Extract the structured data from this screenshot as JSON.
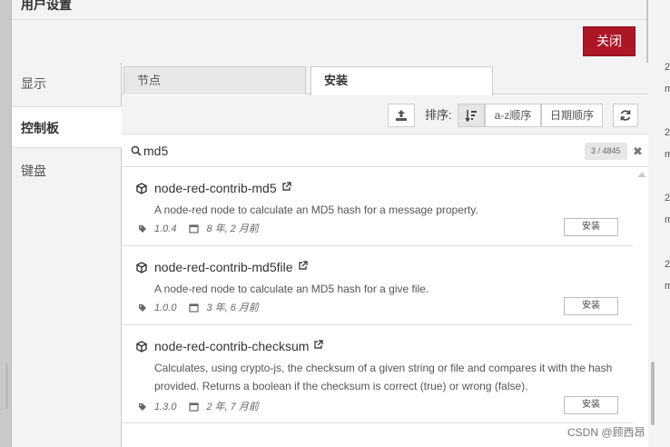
{
  "background": {
    "right_items": [
      "2",
      "m",
      "2",
      "m",
      "2",
      "m",
      "2",
      "m"
    ]
  },
  "dialog": {
    "title": "用户设置",
    "close_label": "关闭"
  },
  "sidebar": {
    "items": [
      {
        "label": "显示"
      },
      {
        "label": "控制板"
      },
      {
        "label": "键盘"
      }
    ]
  },
  "tabs": [
    {
      "label": "节点"
    },
    {
      "label": "安装"
    }
  ],
  "toolbar": {
    "sort_label": "排序:",
    "sort_az": "a-z顺序",
    "sort_date": "日期顺序"
  },
  "search": {
    "value": "md5",
    "count": "3 / 4845",
    "clear": "✖"
  },
  "packages": [
    {
      "name": "node-red-contrib-md5",
      "description": "A node-red node to calculate an MD5 hash for a message property.",
      "version": "1.0.4",
      "updated": "8 年, 2 月前",
      "install_label": "安装"
    },
    {
      "name": "node-red-contrib-md5file",
      "description": "A node-red node to calculate an MD5 hash for a give file.",
      "version": "1.0.0",
      "updated": "3 年, 6 月前",
      "install_label": "安装"
    },
    {
      "name": "node-red-contrib-checksum",
      "description": "Calculates, using crypto-js, the checksum of a given string or file and compares it with the hash provided. Returns a boolean if the checksum is correct (true) or wrong (false).",
      "version": "1.3.0",
      "updated": "2 年, 7 月前",
      "install_label": "安装"
    }
  ],
  "watermark": "CSDN @顾西昂",
  "colors": {
    "accent": "#ad1625"
  }
}
